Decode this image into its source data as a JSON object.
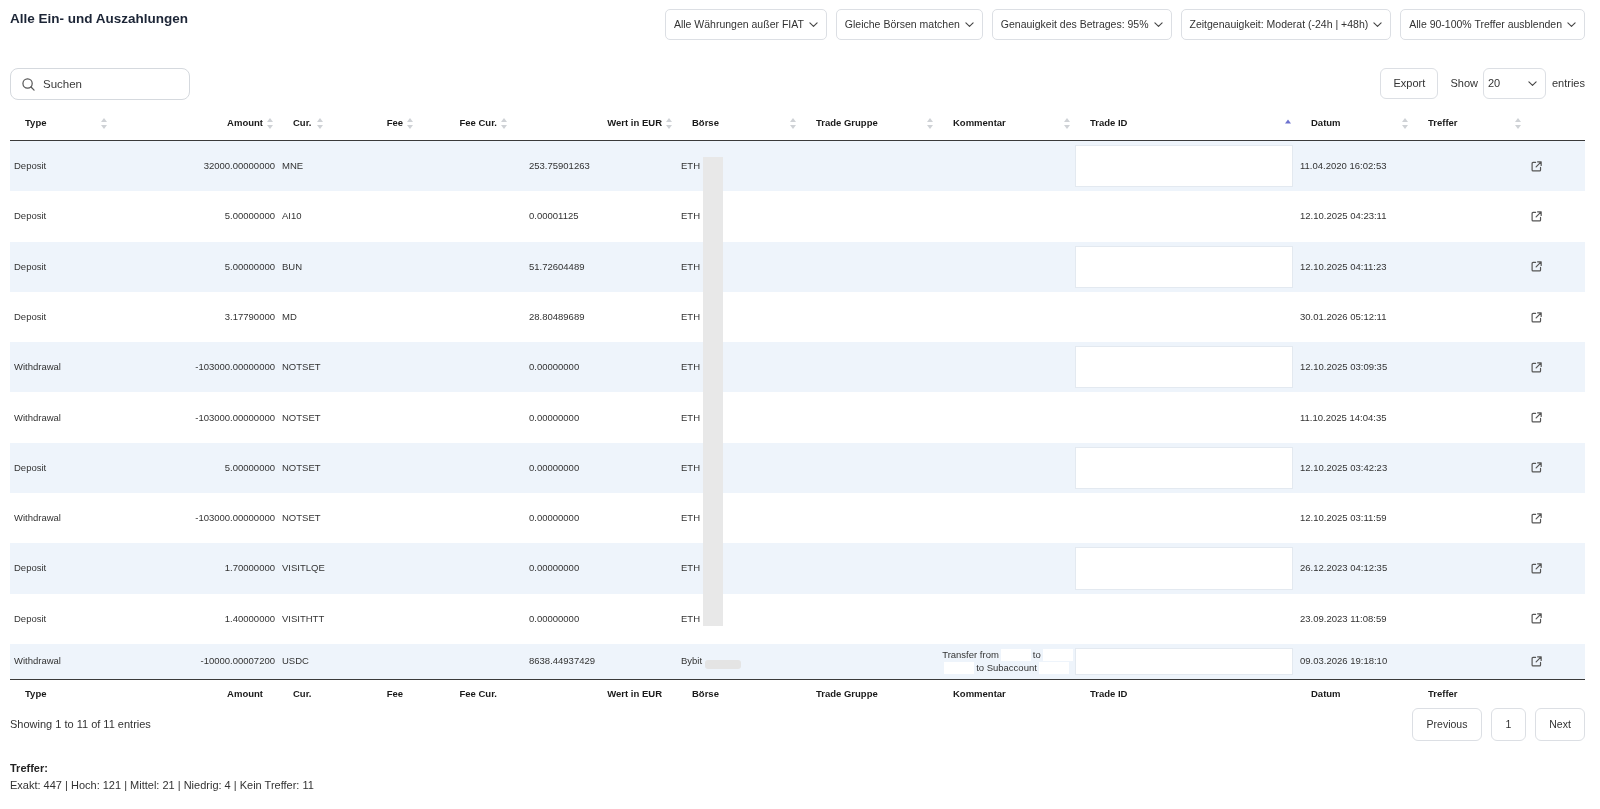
{
  "title": "Alle Ein- und Auszahlungen",
  "filters": [
    {
      "label": "Alle Währungen außer FIAT"
    },
    {
      "label": "Gleiche Börsen matchen"
    },
    {
      "label": "Genauigkeit des Betrages: 95%"
    },
    {
      "label": "Zeitgenauigkeit: Moderat (-24h | +48h)"
    },
    {
      "label": "Alle 90-100% Treffer ausblenden"
    }
  ],
  "search": {
    "placeholder": "Suchen"
  },
  "export_button": {
    "label": "Export"
  },
  "page_length": {
    "before": "Show",
    "value": "20",
    "after": "entries"
  },
  "table": {
    "columns": [
      {
        "label": "Type",
        "sorted": false
      },
      {
        "label": "Amount",
        "sorted": false
      },
      {
        "label": "Cur.",
        "sorted": false
      },
      {
        "label": "Fee",
        "sorted": false
      },
      {
        "label": "Fee Cur.",
        "sorted": false
      },
      {
        "label": "Wert in EUR",
        "sorted": false
      },
      {
        "label": "Börse",
        "sorted": false
      },
      {
        "label": "Trade Gruppe",
        "sorted": false
      },
      {
        "label": "Kommentar",
        "sorted": false
      },
      {
        "label": "Trade ID",
        "sorted": true
      },
      {
        "label": "Datum",
        "sorted": false
      },
      {
        "label": "Treffer",
        "sorted": false
      }
    ],
    "rows": [
      {
        "type": "Deposit",
        "amount": "32000.00000000",
        "currency": "MNE",
        "value_eur": "253.75901263",
        "exchange": "ETH",
        "exchange_redacted": false,
        "trade_id_redacted": true,
        "date": "11.04.2020 16:02:53"
      },
      {
        "type": "Deposit",
        "amount": "5.00000000",
        "currency": "AI10",
        "value_eur": "0.00001125",
        "exchange": "ETH",
        "exchange_redacted": false,
        "trade_id_redacted": false,
        "date": "12.10.2025 04:23:11"
      },
      {
        "type": "Deposit",
        "amount": "5.00000000",
        "currency": "BUN",
        "value_eur": "51.72604489",
        "exchange": "ETH",
        "exchange_redacted": false,
        "trade_id_redacted": true,
        "date": "12.10.2025 04:11:23"
      },
      {
        "type": "Deposit",
        "amount": "3.17790000",
        "currency": "MD",
        "value_eur": "28.80489689",
        "exchange": "ETH",
        "exchange_redacted": false,
        "trade_id_redacted": false,
        "date": "30.01.2026 05:12:11"
      },
      {
        "type": "Withdrawal",
        "amount": "-103000.00000000",
        "currency": "NOTSET",
        "value_eur": "0.00000000",
        "exchange": "ETH",
        "exchange_redacted": false,
        "trade_id_redacted": true,
        "date": "12.10.2025 03:09:35"
      },
      {
        "type": "Withdrawal",
        "amount": "-103000.00000000",
        "currency": "NOTSET",
        "value_eur": "0.00000000",
        "exchange": "ETH",
        "exchange_redacted": false,
        "trade_id_redacted": false,
        "date": "11.10.2025 14:04:35"
      },
      {
        "type": "Deposit",
        "amount": "5.00000000",
        "currency": "NOTSET",
        "value_eur": "0.00000000",
        "exchange": "ETH",
        "exchange_redacted": false,
        "trade_id_redacted": true,
        "date": "12.10.2025 03:42:23"
      },
      {
        "type": "Withdrawal",
        "amount": "-103000.00000000",
        "currency": "NOTSET",
        "value_eur": "0.00000000",
        "exchange": "ETH",
        "exchange_redacted": false,
        "trade_id_redacted": false,
        "date": "12.10.2025 03:11:59"
      },
      {
        "type": "Deposit",
        "amount": "1.70000000",
        "currency": "VISITLQE",
        "value_eur": "0.00000000",
        "exchange": "ETH",
        "exchange_redacted": false,
        "trade_id_redacted": true,
        "date": "26.12.2023 04:12:35"
      },
      {
        "type": "Deposit",
        "amount": "1.40000000",
        "currency": "VISITHTT",
        "value_eur": "0.00000000",
        "exchange": "ETH",
        "exchange_redacted": false,
        "trade_id_redacted": false,
        "date": "23.09.2023 11:08:59"
      },
      {
        "type": "Withdrawal",
        "amount": "-10000.00007200",
        "currency": "USDC",
        "value_eur": "8638.44937429",
        "exchange": "Bybit",
        "exchange_redacted": true,
        "trade_id_redacted": true,
        "date": "09.03.2026 19:18:10",
        "comment": [
          [
            {
              "kind": "text",
              "text": "Transfer from"
            },
            {
              "kind": "redacted"
            },
            {
              "kind": "text",
              "text": "to"
            },
            {
              "kind": "redacted"
            }
          ],
          [
            {
              "kind": "redacted"
            },
            {
              "kind": "text",
              "text": "to Subaccount"
            },
            {
              "kind": "redacted"
            }
          ]
        ]
      }
    ],
    "redaction_bar": true,
    "footer_columns": [
      "Type",
      "Amount",
      "Cur.",
      "Fee",
      "Fee Cur.",
      "Wert in EUR",
      "Börse",
      "Trade Gruppe",
      "Kommentar",
      "Trade ID",
      "Datum",
      "Treffer"
    ]
  },
  "info": "Showing 1 to 11 of 11 entries",
  "pagination": [
    {
      "label": "Previous"
    },
    {
      "label": "1"
    },
    {
      "label": "Next"
    }
  ],
  "summary": {
    "title": "Treffer:",
    "text": "Exakt: 447 | Hoch: 121 | Mittel: 21 | Niedrig: 4 | Kein Treffer: 11"
  }
}
